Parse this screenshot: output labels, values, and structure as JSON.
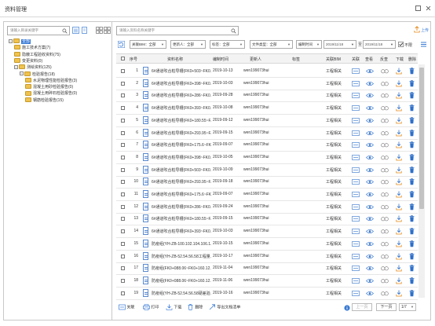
{
  "window": {
    "title": "资料管理"
  },
  "left": {
    "search_placeholder": "请输入目录关键字",
    "tree": [
      {
        "label": "全部",
        "level": 0,
        "expander": "−",
        "selected": true
      },
      {
        "label": "施工技术方案(7)",
        "level": 1,
        "expander": "",
        "selected": false
      },
      {
        "label": "隐蔽工程验收资料(75)",
        "level": 1,
        "expander": "",
        "selected": false
      },
      {
        "label": "变更资料(0)",
        "level": 1,
        "expander": "",
        "selected": false
      },
      {
        "label": "测绘资料(125)",
        "level": 1,
        "expander": "−",
        "selected": false
      },
      {
        "label": "检验报告(18)",
        "level": 2,
        "expander": "−",
        "selected": false
      },
      {
        "label": "水泥物理性能检验报告(3)",
        "level": 3,
        "expander": "",
        "selected": false
      },
      {
        "label": "混凝土用砂检验报告(0)",
        "level": 3,
        "expander": "",
        "selected": false
      },
      {
        "label": "混凝土用碎石检验报告(0)",
        "level": 3,
        "expander": "",
        "selected": false
      },
      {
        "label": "钢筋检验报告(15)",
        "level": 3,
        "expander": "",
        "selected": false
      }
    ]
  },
  "right": {
    "search_placeholder": "请输入资料名称关键字",
    "upload_label": "上传",
    "filters": [
      {
        "label": "关联BIM：全部"
      },
      {
        "label": "更新人：全部"
      },
      {
        "label": "标签：全部"
      },
      {
        "label": "文件类型：全部"
      },
      {
        "label": "编制时间"
      }
    ],
    "date_from": "2019/11/18",
    "date_to": "2019/11/18",
    "date_sep": "至",
    "unlimited_label": "不限",
    "columns": [
      "序号",
      "资料名称",
      "编制时间",
      "更新人",
      "标签",
      "关联BIM",
      "关联",
      "查看",
      "反查",
      "下载",
      "删除"
    ],
    "rows": [
      {
        "no": "1",
        "name": "6#通道吹合桩导槽(FK0+503~FK0...",
        "date": "2019-10-13",
        "user": "wen199073hui",
        "bim": "工程相关"
      },
      {
        "no": "2",
        "name": "6#通道吹合桩导槽(FK0+398~FK0...",
        "date": "2019-10-03",
        "user": "wen199073hui",
        "bim": "工程相关"
      },
      {
        "no": "3",
        "name": "6#通道吹合桩导槽(FK0+286~FK0...",
        "date": "2019-09-28",
        "user": "wen199073hui",
        "bim": "工程相关"
      },
      {
        "no": "4",
        "name": "6#通道吹合桩导槽(FK0+393~FK0...",
        "date": "2019-10-08",
        "user": "wen199073hui",
        "bim": "工程相关"
      },
      {
        "no": "5",
        "name": "6#通道吹合桩导槽(FK0+180.55~F...",
        "date": "2019-09-12",
        "user": "wen199073hui",
        "bim": "工程相关"
      },
      {
        "no": "6",
        "name": "6#通道吹合桩导槽(FK0+293.95~F...",
        "date": "2019-09-15",
        "user": "wen199073hui",
        "bim": "工程相关"
      },
      {
        "no": "7",
        "name": "6#通道吹合桩导槽(FK0+175.6~FK...",
        "date": "2019-09-07",
        "user": "wen199073hui",
        "bim": "工程相关"
      },
      {
        "no": "8",
        "name": "6#通道吹合桩导槽(FK0+398~FK0...",
        "date": "2019-10-05",
        "user": "wen199073hui",
        "bim": "工程相关"
      },
      {
        "no": "9",
        "name": "6#通道吹合桩导槽(FK0+503~FK0...",
        "date": "2019-10-09",
        "user": "wen199073hui",
        "bim": "工程相关"
      },
      {
        "no": "10",
        "name": "6#通道吹合桩导槽(FK0+293.95~F...",
        "date": "2019-09-18",
        "user": "wen199073hui",
        "bim": "工程相关"
      },
      {
        "no": "11",
        "name": "6#通道吹合桩导槽(FK0+175.6~FK...",
        "date": "2019-09-07",
        "user": "wen199073hui",
        "bim": "工程相关"
      },
      {
        "no": "12",
        "name": "6#通道吹合桩导槽(FK0+286~FK0...",
        "date": "2019-09-24",
        "user": "wen199073hui",
        "bim": "工程相关"
      },
      {
        "no": "13",
        "name": "6#通道吹合桩导槽(FK0+180.55~F...",
        "date": "2019-09-15",
        "user": "wen199073hui",
        "bim": "工程相关"
      },
      {
        "no": "14",
        "name": "6#通道吹合桩导槽(FK0+393~FK0...",
        "date": "2019-10-03",
        "user": "wen199073hui",
        "bim": "工程相关"
      },
      {
        "no": "15",
        "name": "防疫组(YH-ZB-100.102.104.106.1...",
        "date": "2019-10-15",
        "user": "wen199073hui",
        "bim": "工程相关"
      },
      {
        "no": "16",
        "name": "防疫组(YH-ZB-52.54.56.58工程量...",
        "date": "2019-10-17",
        "user": "wen199073hui",
        "bim": "工程相关"
      },
      {
        "no": "17",
        "name": "防疫组(FK0+088.06~FK0+160.12...",
        "date": "2019-11-04",
        "user": "wen199073hui",
        "bim": "工程相关"
      },
      {
        "no": "18",
        "name": "防疫组(FK0+088.06~FK0+160.12...",
        "date": "2019-11-06",
        "user": "wen199073hui",
        "bim": "工程相关"
      },
      {
        "no": "19",
        "name": "防疫组(YH-ZB-52.54.56.58硬差验...",
        "date": "2019-10-16",
        "user": "wen199073hui",
        "bim": "工程相关"
      }
    ],
    "footer": {
      "buttons": [
        "关联",
        "打印",
        "下载",
        "删除",
        "导出文档清单"
      ],
      "prev_label": "上一页",
      "next_label": "下一页",
      "page_select": "1/7"
    }
  },
  "colors": {
    "accent": "#3a7bd5",
    "delete_icon": "#2e6fc9",
    "download_icon": "#2e6fc9",
    "folder": "#f0c24e"
  }
}
